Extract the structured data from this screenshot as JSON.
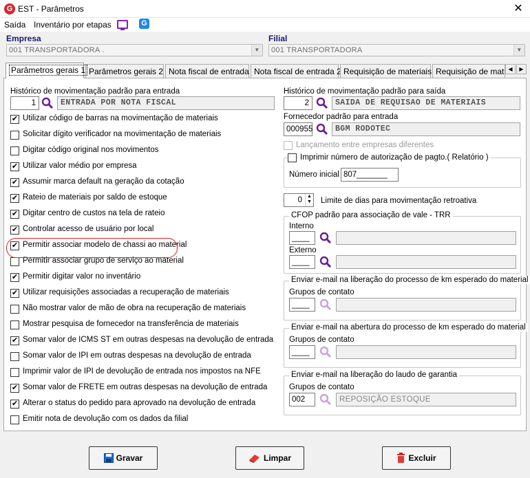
{
  "window": {
    "title": "EST - Parâmetros",
    "close": "✕",
    "logo": "G"
  },
  "menu": [
    "Saída",
    "Inventário por etapas"
  ],
  "empresa": {
    "label": "Empresa",
    "value": "001 TRANSPORTADORA ."
  },
  "filial": {
    "label": "Filial",
    "value": "001 TRANSPORTADORA"
  },
  "tabs": [
    "Parâmetros gerais 1",
    "Parâmetros gerais 2",
    "Nota fiscal de entrada",
    "Nota fiscal de entrada 2",
    "Requisição de materiais",
    "Requisição de materi"
  ],
  "left": {
    "hist_entrada": {
      "label": "Histórico de movimentação padrão para entrada",
      "code": "1",
      "desc": "ENTRADA POR NOTA FISCAL"
    },
    "checkboxes": [
      {
        "label": "Utilizar código de barras na movimentação de materiais",
        "checked": true
      },
      {
        "label": "Solicitar dígito verificador na movimentação de materiais",
        "checked": false
      },
      {
        "label": "Digitar código original nos movimentos",
        "checked": false
      },
      {
        "label": "Utilizar valor médio por empresa",
        "checked": true
      },
      {
        "label": "Assumir marca default na geração da cotação",
        "checked": true
      },
      {
        "label": "Rateio de materiais por saldo de estoque",
        "checked": true
      },
      {
        "label": "Digitar centro de custos na tela de rateio",
        "checked": true
      },
      {
        "label": "Controlar acesso de usuário por local",
        "checked": true
      },
      {
        "label": "Permitir associar modelo de chassi ao material",
        "checked": true
      },
      {
        "label": "Permitir associar grupo de serviço ao material",
        "checked": false
      },
      {
        "label": "Permitir digitar valor no inventário",
        "checked": true
      },
      {
        "label": "Utilizar requisições associadas a recuperação de materiais",
        "checked": true
      },
      {
        "label": "Não mostrar valor de mão de obra na recuperação de materiais",
        "checked": false
      },
      {
        "label": "Mostrar pesquisa de fornecedor na transferência de materiais",
        "checked": false
      },
      {
        "label": "Somar valor de ICMS ST em outras despesas na devolução de entrada",
        "checked": true
      },
      {
        "label": "Somar valor de IPI em outras despesas na devolução de entrada",
        "checked": false
      },
      {
        "label": "Imprimir valor de IPI de devolução de entrada nos impostos na NFE",
        "checked": false
      },
      {
        "label": "Somar valor de FRETE em outras despesas na devolução de entrada",
        "checked": true
      },
      {
        "label": "Alterar o status do pedido para aprovado na devolução de entrada",
        "checked": true
      },
      {
        "label": "Emitir nota de devolução com os dados da filial",
        "checked": false
      }
    ]
  },
  "right": {
    "hist_saida": {
      "label": "Histórico de movimentação padrão para saída",
      "code": "2",
      "desc": "SAIDA DE REQUISAO DE MATERIAIS"
    },
    "fornecedor": {
      "label": "Fornecedor padrão para entrada",
      "code": "000955",
      "desc": "BGM RODOTEC"
    },
    "lancamento": {
      "label": "Lançamento entre empresas diferentes"
    },
    "imprimir": {
      "label": "Imprimir número de autorização de pagto.( Relatório )",
      "numero_label": "Número inicial",
      "numero": "807_______"
    },
    "limite": {
      "value": "0",
      "label": "Limite de dias para movimentação retroativa"
    },
    "cfop": {
      "title": "CFOP padrão para associação de vale - TRR",
      "interno": "Interno",
      "externo": "Externo",
      "blank": "____"
    },
    "email1": {
      "title": "Enviar e-mail na liberação do processo de km esperado do material",
      "grupos": "Grupos de contato",
      "code": "____"
    },
    "email2": {
      "title": "Enviar e-mail na abertura do processo de km esperado do material",
      "grupos": "Grupos de contato",
      "code": "____"
    },
    "email3": {
      "title": "Enviar e-mail na liberação do laudo de garantia",
      "grupos": "Grupos de contato",
      "code": "002",
      "desc": "REPOSIÇÃO ESTOQUE"
    }
  },
  "buttons": {
    "gravar": "Gravar",
    "limpar": "Limpar",
    "excluir": "Excluir"
  },
  "colors": {
    "accent": "#1a1a6c",
    "highlight": "#d62020",
    "search": "#6a1b9a"
  }
}
